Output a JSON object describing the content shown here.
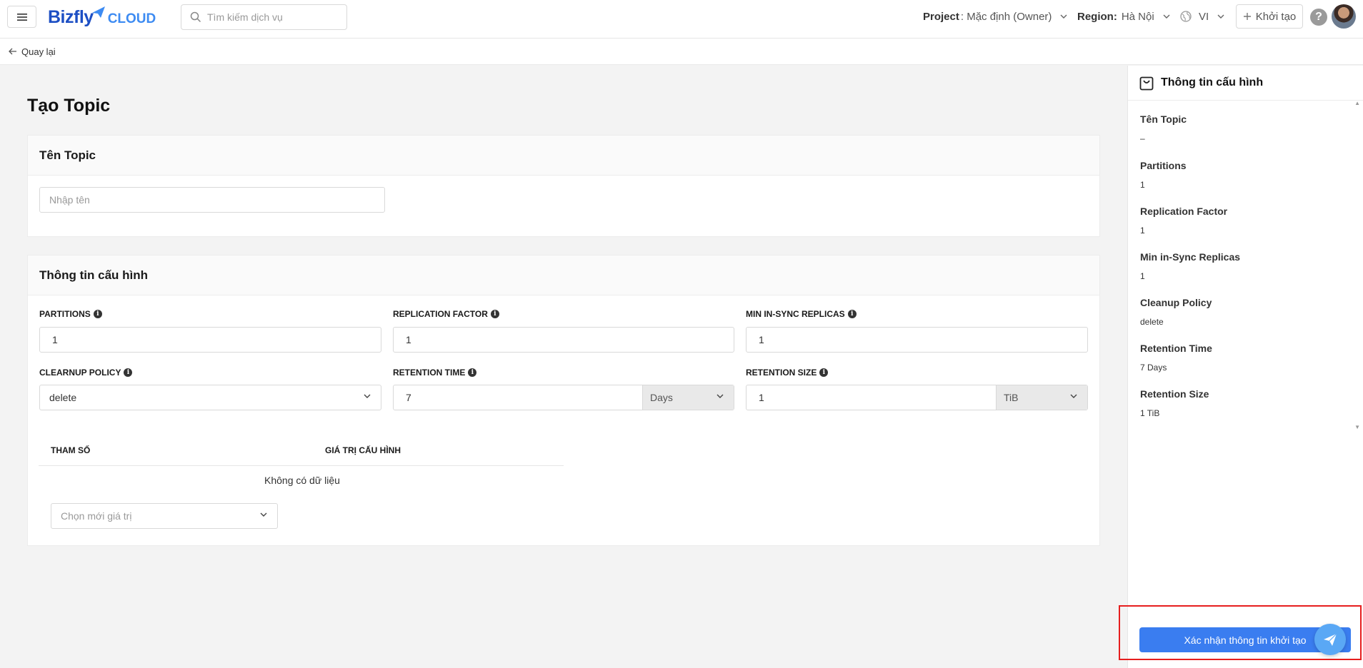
{
  "header": {
    "brand_main": "Bizfly",
    "brand_sub": "CLOUD",
    "search_placeholder": "Tìm kiếm dịch vụ",
    "project_label": "Project",
    "project_value": ": Mặc định (Owner)",
    "region_label": "Region:",
    "region_value": "Hà Nội",
    "language": "VI",
    "create_label": "Khởi tạo",
    "help_glyph": "?"
  },
  "nav": {
    "back_label": "Quay lại"
  },
  "page": {
    "title": "Tạo Topic",
    "topic_section": {
      "title": "Tên Topic",
      "name_placeholder": "Nhập tên"
    },
    "config_section": {
      "title": "Thông tin cấu hình",
      "partitions_label": "PARTITIONS",
      "partitions_value": "1",
      "replication_label": "REPLICATION FACTOR",
      "replication_value": "1",
      "min_isr_label": "MIN IN-SYNC REPLICAS",
      "min_isr_value": "1",
      "cleanup_label": "CLEARNUP POLICY",
      "cleanup_value": "delete",
      "retention_time_label": "RETENTION TIME",
      "retention_time_value": "7",
      "retention_time_unit": "Days",
      "retention_size_label": "RETENTION SIZE",
      "retention_size_value": "1",
      "retention_size_unit": "TiB",
      "table_col_param": "THAM SỐ",
      "table_col_value": "GIÁ TRỊ CẤU HÌNH",
      "table_empty": "Không có dữ liệu",
      "new_value_placeholder": "Chọn mới giá trị"
    }
  },
  "summary": {
    "title": "Thông tin cấu hình",
    "items": [
      {
        "key": "Tên Topic",
        "value": "–"
      },
      {
        "key": "Partitions",
        "value": "1"
      },
      {
        "key": "Replication Factor",
        "value": "1"
      },
      {
        "key": "Min in-Sync Replicas",
        "value": "1"
      },
      {
        "key": "Cleanup Policy",
        "value": "delete"
      },
      {
        "key": "Retention Time",
        "value": "7 Days"
      },
      {
        "key": "Retention Size",
        "value": "1 TiB"
      }
    ],
    "confirm_label": "Xác nhận thông tin khởi tạo"
  },
  "colors": {
    "accent": "#3a7df0",
    "highlight_border": "#e61e1e",
    "brand": "#1d4fc4"
  }
}
